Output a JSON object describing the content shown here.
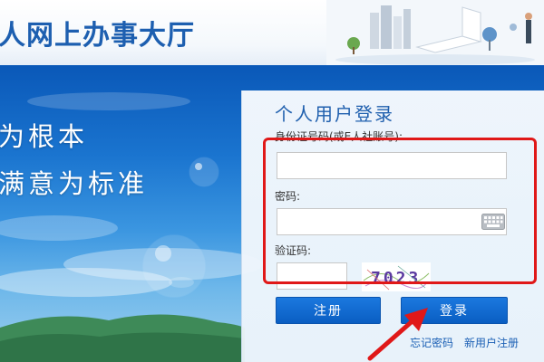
{
  "header": {
    "site_title": "人网上办事大厅"
  },
  "banner": {
    "slogan_line1": "为根本",
    "slogan_line2": "满意为标准"
  },
  "login": {
    "title": "个人用户登录",
    "id_label": "身份证号码(或E人社账号):",
    "id_value": "",
    "password_label": "密码:",
    "password_value": "",
    "captcha_label": "验证码:",
    "captcha_value": "",
    "captcha_text": "7023",
    "register_label": "注册",
    "login_label": "登录",
    "forgot_link": "忘记密码",
    "new_user_link": "新用户注册"
  },
  "colors": {
    "brand_blue": "#1d5fb0",
    "button_blue": "#0a5ec2",
    "highlight_red": "#e01818"
  },
  "icons": {
    "keyboard": "keyboard-icon",
    "arrow": "red-arrow-annotation"
  }
}
